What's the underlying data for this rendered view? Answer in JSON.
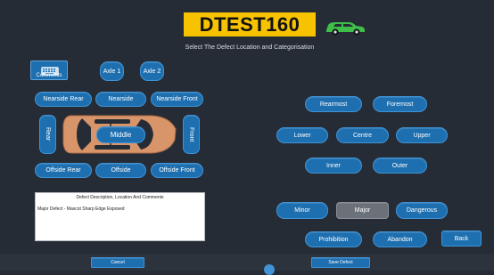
{
  "header": {
    "registration": "DTEST160",
    "subtitle": "Select The Defect Location and Categorisation"
  },
  "colors": {
    "background": "#262c35",
    "button": "#1e6fb0",
    "plate": "#f7c300",
    "vehicle_icon": "#3fbf4a",
    "car_body": "#d9956a",
    "selected": "#6b7178"
  },
  "comments": {
    "label": "Comments",
    "icon": "keyboard-icon"
  },
  "axles": [
    "Axle 1",
    "Axle 2"
  ],
  "location": {
    "nearside": [
      "Nearside Rear",
      "Nearside",
      "Nearside Front"
    ],
    "rear": "Rear",
    "middle": "Middle",
    "front": "Front",
    "offside": [
      "Offside Rear",
      "Offside",
      "Offside Front"
    ]
  },
  "position": {
    "longitudinal": [
      "Rearmost",
      "Foremost"
    ],
    "vertical": [
      "Lower",
      "Centre",
      "Upper"
    ],
    "lateral": [
      "Inner",
      "Outer"
    ]
  },
  "severity": {
    "options": [
      "Minor",
      "Major",
      "Dangerous"
    ],
    "selected": "Major"
  },
  "actions": [
    "Prohibition",
    "Abandon"
  ],
  "back_label": "Back",
  "description": {
    "title": "Defect Description, Location And Comments",
    "text": "Major Defect - Mascot Sharp Edge Exposed"
  },
  "footer": {
    "cancel": "Cancel",
    "save": "Save Defect"
  }
}
